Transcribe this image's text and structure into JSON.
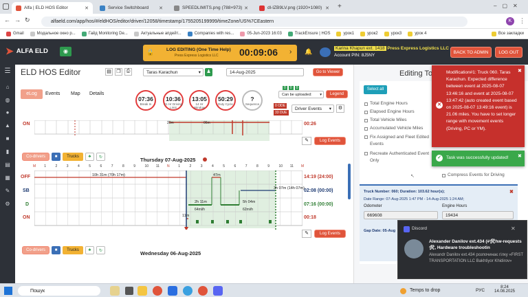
{
  "browser": {
    "tabs": [
      {
        "label": "Alfa | ELD HOS Editor",
        "color": "#e0543b",
        "active": true
      },
      {
        "label": "Service Switchboard",
        "color": "#3b82c4",
        "active": false
      },
      {
        "label": "SPEEDLIMITS.png (788×973)",
        "color": "#999",
        "active": false
      },
      {
        "label": "dl-IZB9LV.png (1920×1080)",
        "color": "#d33",
        "active": false
      }
    ],
    "url": "alfaeld.com/app/hos/#/eldHOS/editor/driver/12058/timestamp/1755205199999/timeZone/US%7CEastern",
    "bookmarks": [
      "Gmail",
      "Модальное окно р...",
      "Гайд Monitoring De...",
      "Актуальные апдейт...",
      "Companies with res...",
      "05-Jun-2023 16:03",
      "TrackEnsure | HOS",
      "урок1",
      "урок2",
      "урок3",
      "урок 4"
    ],
    "all_bookmarks": "Все закладки"
  },
  "header": {
    "logo": "ALFA ELD",
    "login_title": "LOG EDITING (One Time Help)",
    "login_sub": "Press Express Logistics LLC",
    "timer": "00:09:06",
    "user_name": "Karina Khapun ext. 1418",
    "company": "Press Express Logistics LLC",
    "account_pin": "Account PIN: 8J5NY",
    "back_admin": "BACK TO ADMIN",
    "logout": "LOG OUT"
  },
  "editor": {
    "title": "ELD HOS Editor",
    "driver": "Taras Karachun",
    "date": "14-Aug-2025",
    "goto": "Go to Viewer",
    "tabs": [
      "eLog",
      "Events",
      "Map",
      "Details"
    ],
    "gauges": [
      {
        "value": "07:36",
        "label": "Break In"
      },
      {
        "value": "10:36",
        "label": "11 Hr Driving Limit"
      },
      {
        "value": "13:05",
        "label": "14 Hr Window"
      },
      {
        "value": "50:29",
        "label": "Duty Cycle"
      },
      {
        "value": "?",
        "label": "Sequence"
      }
    ],
    "upload_badges": [
      "0",
      "0",
      "0"
    ],
    "can_upload": "Can be uploaded:",
    "legend": "Legend",
    "ode": "0 ODE",
    "due": "33 DUE",
    "driver_events": "Driver Events",
    "on_label": "ON",
    "on_value_top": "00:26",
    "log_events": "Log Events",
    "co_drivers": "Co-drivers",
    "trucks": "Trucks",
    "day1_title": "Thursday 07-Aug-2025",
    "hours": [
      "M",
      "1",
      "2",
      "3",
      "4",
      "5",
      "6",
      "7",
      "8",
      "9",
      "10",
      "11",
      "N",
      "1",
      "2",
      "3",
      "4",
      "5",
      "6",
      "7",
      "8",
      "9",
      "10",
      "11",
      "M"
    ],
    "rows": [
      {
        "label": "OFF",
        "value": "14:19 (24:00)",
        "color": "red"
      },
      {
        "label": "SB",
        "value": "02:08 (00:00)",
        "color": "blue"
      },
      {
        "label": "D",
        "value": "07:16 (00:00)",
        "color": "green"
      },
      {
        "label": "ON",
        "value": "00:18",
        "color": "red"
      }
    ],
    "annotations": {
      "off_dur": "10h 31m (70h 17m)",
      "off_dur2": "47m",
      "sb_dur": "3h 07m (14h 07m)",
      "d1": "2h 11m",
      "d1_speed": "64mi/h",
      "d2": "5h 04m",
      "d2_speed": "62mi/h",
      "on_dur": "11m",
      "top_a": "20m",
      "top_b": "06m"
    },
    "day2_title": "Wednesday 06-Aug-2025"
  },
  "right_panel": {
    "title": "Editing To",
    "select_all": "Select all",
    "fields": [
      "Total Engine Hours",
      "Elapsed Engine Hours",
      "Total Vehicle Miles",
      "Accumulated Vehicle Miles"
    ],
    "fix_assigned": "Fix Assigned and Fleet Edited Events",
    "recreate": "Recreate Authenticated Event Only",
    "compress": "Compress Events for Driving",
    "truck_info": "Truck Number: 060; Duration: 103.62 hour(s);",
    "date_range": "Date Range: 07-Aug-2025 1:47 PM - 14-Aug-2025 1:24 AM;",
    "odometer_label": "Odometer",
    "odometer": "669608",
    "engine_label": "Engine Hours",
    "engine": "19434",
    "gap": "Gap Date: 05-Aug"
  },
  "toasts": {
    "error": "Modification#1: Truck 060. Taras Karachun. Expected difference between event at 2025-08-07 13:46:16 and event at 2025-08-07 13:47:42 (auto created event based on 2025-08-07 13:49:16 event) is 21.06 miles. You have to set longer range with movement events (Driving, PC or YM).",
    "success": "Task was successfully updated!"
  },
  "discord": {
    "app": "Discord",
    "title": "Alexander Danilov ext.434 (#🛠hw-requests🛠, Hardware troubleshootin",
    "body": "Alexandr Danilov ext.434 розпочинає гілку «FIRST TRANSPORTATION LLC Bakhtiyor Khidirov»"
  },
  "taskbar": {
    "search": "Пошук",
    "weather": "Temps to drop",
    "lang": "РУС",
    "time": "8:24",
    "date": "14.08.2025"
  },
  "colors": {
    "accent": "#e0543b",
    "header": "#2d3138",
    "drive": "#2e7d32",
    "error": "#c6302c",
    "success": "#3aa84a"
  }
}
